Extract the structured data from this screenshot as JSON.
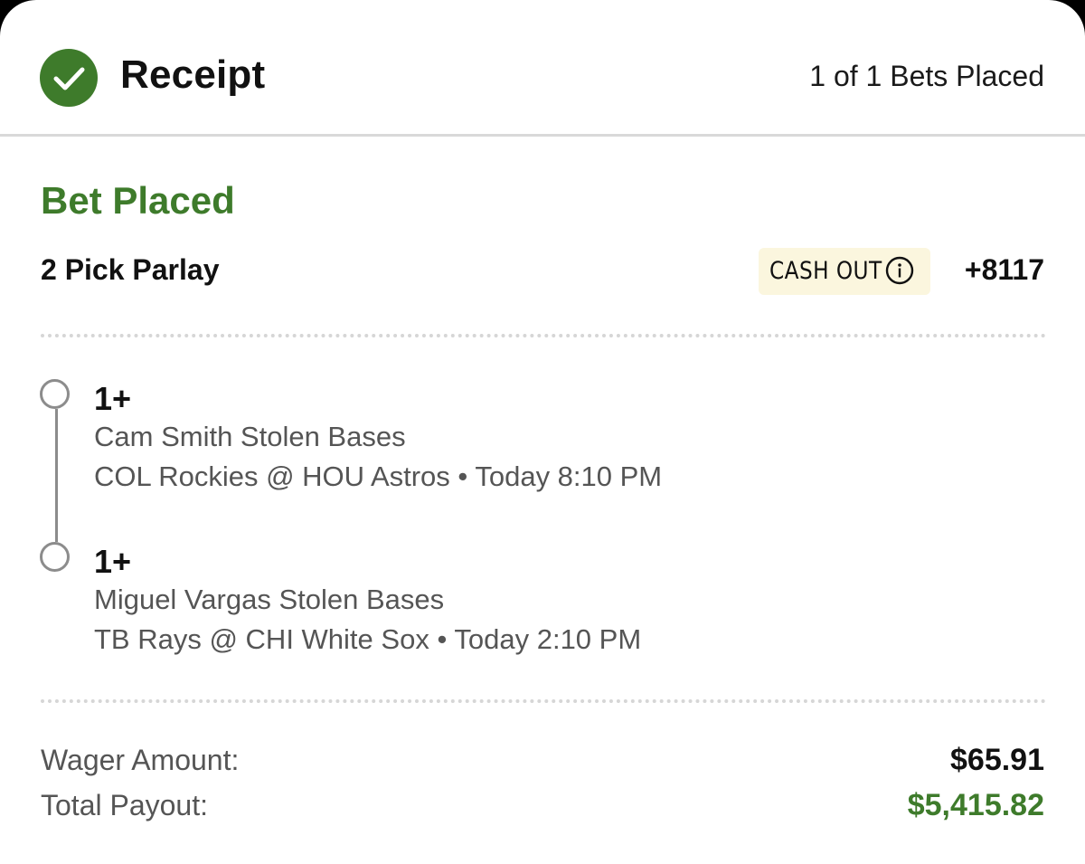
{
  "header": {
    "title": "Receipt",
    "bets_placed": "1 of 1 Bets Placed",
    "check_icon": "check-circle-icon",
    "accent": "#3e7b2b"
  },
  "bet": {
    "status": "Bet Placed",
    "type": "2 Pick Parlay",
    "cash_out_label": "CASH OUT",
    "odds": "+8117"
  },
  "picks": [
    {
      "value": "1+",
      "market": "Cam Smith Stolen Bases",
      "game": "COL Rockies @ HOU Astros",
      "separator": "•",
      "time": "Today 8:10 PM"
    },
    {
      "value": "1+",
      "market": "Miguel Vargas Stolen Bases",
      "game": "TB Rays @ CHI White Sox",
      "separator": "•",
      "time": "Today 2:10 PM"
    }
  ],
  "summary": {
    "wager_label": "Wager Amount:",
    "wager_value": "$65.91",
    "payout_label": "Total Payout:",
    "payout_value": "$5,415.82",
    "payout_color": "#3e7b2b"
  }
}
